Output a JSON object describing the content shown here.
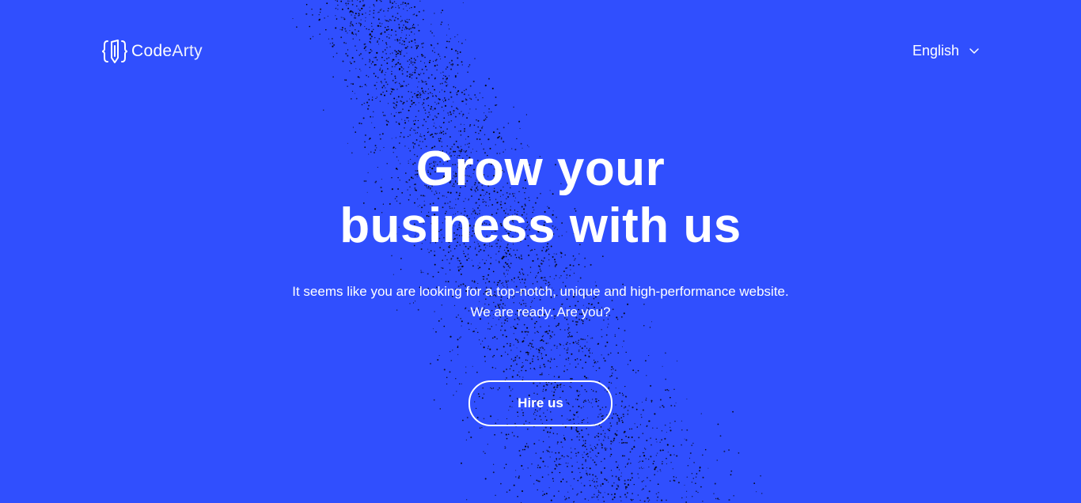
{
  "brand": {
    "name_part1": "Code",
    "name_part2": "Arty",
    "logo_icon": "code-pencil-logo-icon"
  },
  "header": {
    "language_label": "English",
    "language_icon": "chevron-down-icon"
  },
  "hero": {
    "headline_line1": "Grow your",
    "headline_line2": "business with us",
    "subtext_line1": "It seems like you are looking for a top-notch, unique and high-performance website.",
    "subtext_line2": "We are ready. Are you?",
    "cta_label": "Hire us"
  },
  "colors": {
    "background": "#304ffe",
    "text": "#ffffff",
    "particles": "#000000"
  }
}
